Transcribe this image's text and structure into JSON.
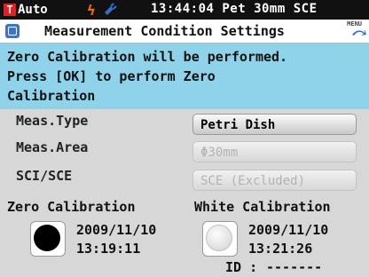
{
  "status_bar": {
    "mode_icon_letter": "T",
    "mode": "Auto",
    "time_info": "13:44:04 Pet 30mm SCE",
    "icons": [
      "mode-icon",
      "power-icon",
      "plug-icon"
    ],
    "power_color": "#f06a00",
    "mode_icon_color": "#e32020"
  },
  "title_bar": {
    "title": "Measurement Condition Settings",
    "menu_label": "MENU"
  },
  "message": {
    "line1": "Zero Calibration will be performed.",
    "line2": "Press [OK] to perform Zero",
    "line3": "Calibration",
    "background": "#8fd3ea"
  },
  "settings": [
    {
      "label": "Meas.Type",
      "value": "Petri Dish",
      "enabled": true
    },
    {
      "label": "Meas.Area",
      "value": "Φ30mm",
      "enabled": false
    },
    {
      "label": "SCI/SCE",
      "value": "SCE (Excluded)",
      "enabled": false
    }
  ],
  "zero_calibration": {
    "heading": "Zero Calibration",
    "date": "2009/11/10",
    "time": "13:19:11",
    "lamp_color": "#000000"
  },
  "white_calibration": {
    "heading": "White Calibration",
    "date": "2009/11/10",
    "time": "13:21:26",
    "lamp_color": "#e6e6e6",
    "id_label": "ID :",
    "id_value": "-------"
  }
}
